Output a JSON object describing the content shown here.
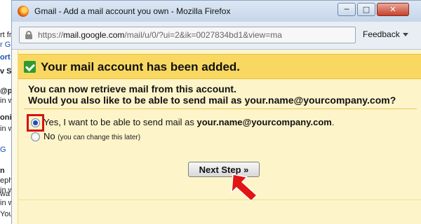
{
  "background": {
    "lines": [
      {
        "text": "rt fr",
        "style": ""
      },
      {
        "text": "r G",
        "style": "blue"
      },
      {
        "text": "ort",
        "style": "blue"
      },
      {
        "text": "v S",
        "style": "bold"
      },
      {
        "text": "@p",
        "style": "bold"
      },
      {
        "text": "in w",
        "style": ""
      },
      {
        "text": "oni",
        "style": "bold"
      },
      {
        "text": "in w",
        "style": ""
      },
      {
        "text": "G",
        "style": "blue"
      },
      {
        "text": "n",
        "style": "bold"
      },
      {
        "text": "eph",
        "style": ""
      },
      {
        "text": "in w",
        "style": ""
      },
      {
        "text": "wa",
        "style": ""
      },
      {
        "text": "in w",
        "style": ""
      },
      {
        "text": "You",
        "style": ""
      }
    ]
  },
  "window": {
    "title": "Gmail - Add a mail account you own - Mozilla Firefox",
    "minimize_glyph": "─",
    "maximize_glyph": "□",
    "close_glyph": "✕"
  },
  "urlbar": {
    "prefix": "https://",
    "domain": "mail.google.com",
    "path": "/mail/u/0/?ui=2&ik=0027834bd1&view=ma",
    "feedback_label": "Feedback"
  },
  "icons": {
    "browser": "firefox-icon",
    "lock": "lock-icon",
    "check": "checkmark-icon",
    "pointer": "red-arrow-icon"
  },
  "notice": {
    "heading": "Your mail account has been added.",
    "line1": "You can now retrieve mail from this account.",
    "line2": "Would you also like to be able to send mail as your.name@yourcompany.com?"
  },
  "options": {
    "yes_prefix": "Yes, I want to be able to send mail as ",
    "yes_email": "your.name@yourcompany.com",
    "yes_suffix": ".",
    "no_label": "No",
    "no_hint": "(you can change this later)",
    "selected": "yes"
  },
  "next_button": {
    "label": "Next Step »"
  },
  "colors": {
    "header": "#f9d862",
    "panel": "#fdf4c9",
    "highlight_box": "#d41313",
    "arrow": "#e21414"
  }
}
